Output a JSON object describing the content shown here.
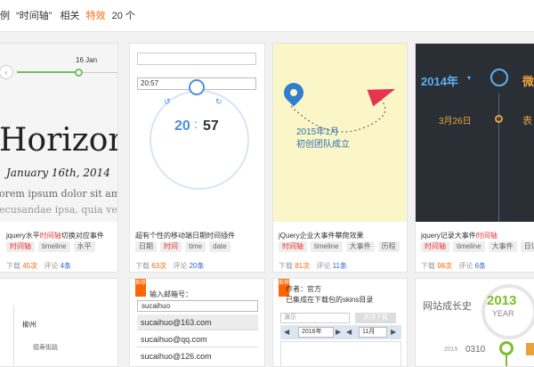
{
  "topbar": {
    "prefix": "例",
    "quoted": "“时间轴”",
    "mid": "相关",
    "hl": "特效",
    "count": "20 个"
  },
  "cards": [
    {
      "thumb": {
        "date_label": "16 Jan",
        "big_word": "Horizon",
        "date_line": "January 16th, 2014",
        "lorem1": "orem ipsum dolor sit amet",
        "lorem2": "ecusandae ipsa, quia velit n"
      },
      "title_pre": "jquery水平",
      "title_red": "时间轴",
      "title_post": "切换对应事件",
      "tags": [
        "时间轴",
        "timeline",
        "水平"
      ],
      "tag_red": [
        true,
        false,
        false
      ],
      "downloads_label": "下载",
      "downloads": "45次",
      "comments_label": "评论",
      "comments": "4条"
    },
    {
      "thumb": {
        "time_input": "20:57",
        "hour": "20",
        "minute": "57"
      },
      "title_pre": "超有个性的移动端日期时间插件",
      "title_red": "",
      "title_post": "",
      "tags": [
        "日期",
        "时间",
        "time",
        "date"
      ],
      "tag_red": [
        false,
        true,
        false,
        false
      ],
      "downloads_label": "下载",
      "downloads": "63次",
      "comments_label": "评论",
      "comments": "20条"
    },
    {
      "thumb": {
        "year_month": "2015年1月",
        "event": "初创团队成立"
      },
      "title_pre": "jQuery企业大事件攀爬效果",
      "title_red": "",
      "title_post": "",
      "tags": [
        "时间轴",
        "timeline",
        "大事件",
        "历程"
      ],
      "tag_red": [
        true,
        false,
        false,
        false
      ],
      "downloads_label": "下载",
      "downloads": "81次",
      "comments_label": "评论",
      "comments": "11条"
    },
    {
      "thumb": {
        "year": "2014年",
        "date": "3月26日",
        "extra1": "微",
        "extra2": "表"
      },
      "title_pre": "jquery记录大事件",
      "title_red": "时间轴",
      "title_post": "",
      "tags": [
        "时间轴",
        "timeline",
        "大事件",
        "日记"
      ],
      "tag_red": [
        true,
        false,
        false,
        false
      ],
      "downloads_label": "下载",
      "downloads": "98次",
      "comments_label": "评论",
      "comments": "6条"
    }
  ],
  "row2": {
    "c1": {
      "city": "柳州",
      "sub": "德寿街路"
    },
    "c2": {
      "ribbon": "推荐",
      "label": "输入邮箱号：",
      "value": "sucaihuo",
      "options": [
        "sucaihuo@163.com",
        "sucaihuo@qq.com",
        "sucaihuo@126.com"
      ]
    },
    "c3": {
      "ribbon": "推荐",
      "author": "作者：官方",
      "note": "已集成在下载包的skins目录",
      "placeholder": "演示",
      "button": "关闭下载",
      "year": "2016年",
      "month": "11月"
    },
    "c4": {
      "title": "网站成长史",
      "year": "2013",
      "year_word": "YEAR",
      "small_year": "2015",
      "date": "0310"
    }
  }
}
